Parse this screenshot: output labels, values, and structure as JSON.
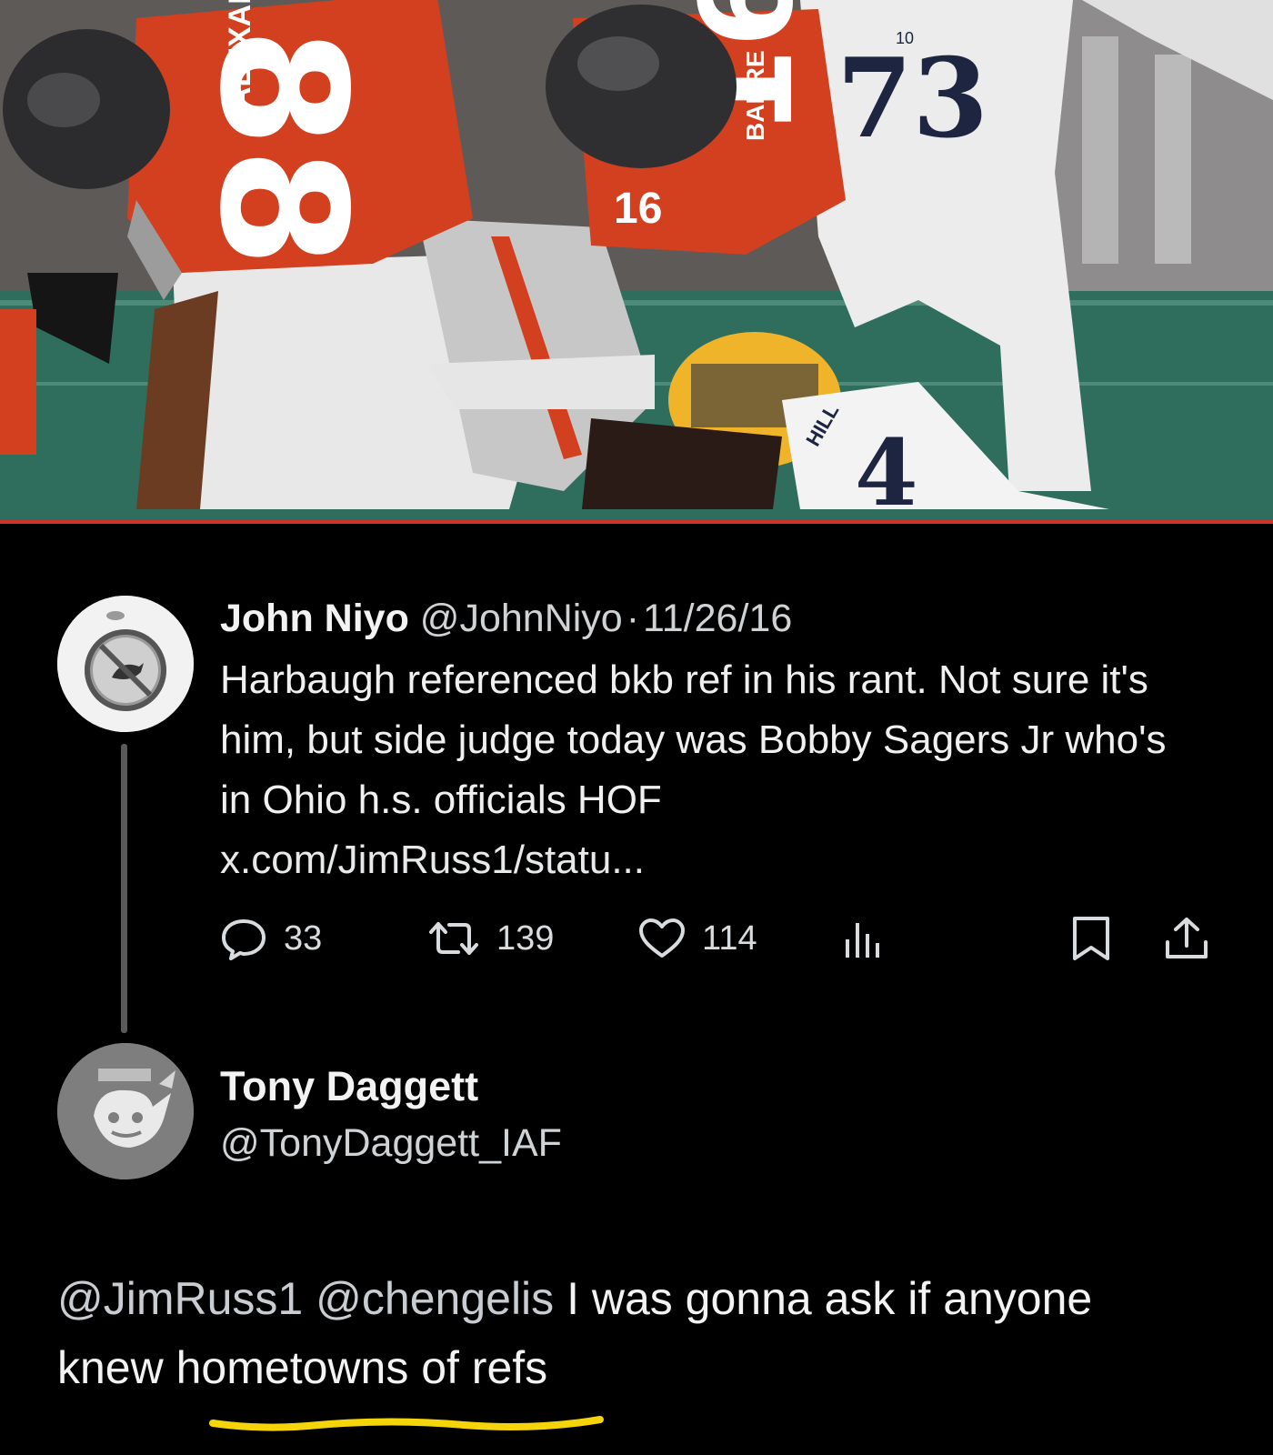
{
  "photo": {
    "jersey_numbers": [
      "88",
      "16",
      "16",
      "73",
      "4"
    ],
    "jersey_names": [
      "ALEXANDER",
      "BARRE",
      "HILL"
    ],
    "patch_text": "10"
  },
  "tweet1": {
    "name": "John Niyo",
    "handle": "@JohnNiyo",
    "separator": "·",
    "date": "11/26/16",
    "text": "Harbaugh referenced bkb ref in his rant. Not sure it's him, but side judge today was Bobby Sagers Jr who's in Ohio h.s. officials HOF",
    "link": "x.com/JimRuss1/statu...",
    "actions": {
      "reply_icon": "reply-icon",
      "replies": "33",
      "retweet_icon": "retweet-icon",
      "retweets": "139",
      "like_icon": "heart-icon",
      "likes": "114",
      "views_icon": "analytics-icon",
      "bookmark_icon": "bookmark-icon",
      "share_icon": "share-icon"
    }
  },
  "tweet2": {
    "name": "Tony Daggett",
    "handle": "@TonyDaggett_IAF",
    "mentions": [
      "@JimRuss1",
      "@chengelis"
    ],
    "text_part1": "I was gonna ask if anyone",
    "text_part2_prefix": "knew ",
    "text_highlight": "hometowns of refs"
  },
  "colors": {
    "background": "#000000",
    "divider": "#d1322a",
    "highlight_underline": "#f5d40a",
    "ohio_state_red": "#d2401f"
  }
}
